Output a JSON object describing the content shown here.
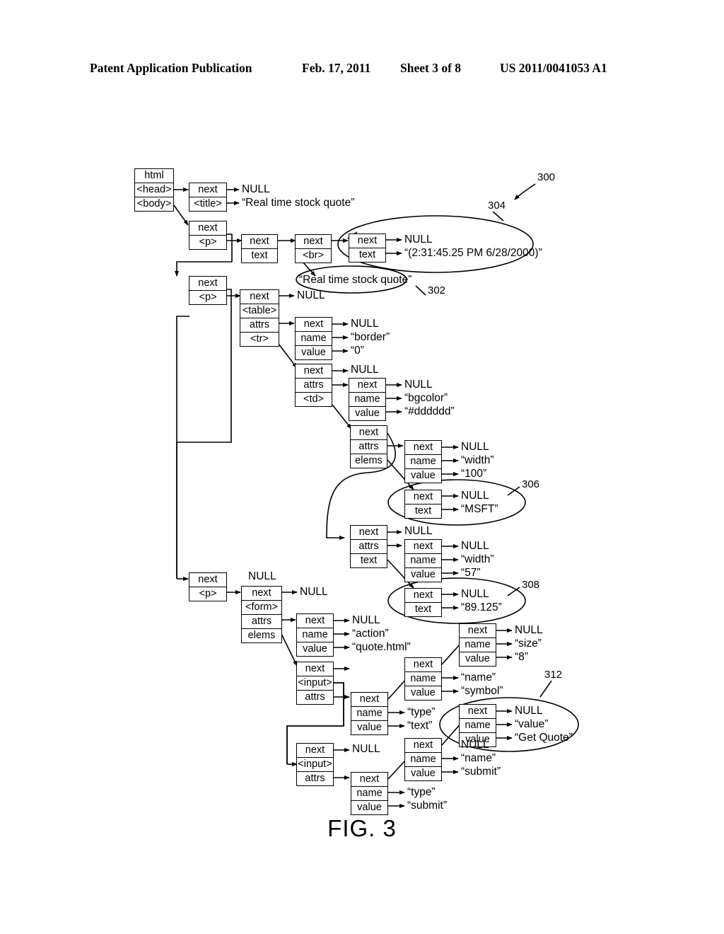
{
  "header": {
    "publication": "Patent Application Publication",
    "date": "Feb. 17, 2011",
    "sheet": "Sheet 3 of 8",
    "number": "US 2011/0041053 A1"
  },
  "figure": {
    "caption": "FIG. 3",
    "diagram_ref": "300"
  },
  "reference_numerals": {
    "r300": "300",
    "r302": "302",
    "r304": "304",
    "r306": "306",
    "r308": "308",
    "r312": "312"
  },
  "nodes": {
    "html_root": {
      "c0": "html",
      "c1": "<head>",
      "c2": "<body>"
    },
    "title": {
      "c0": "next",
      "c1": "<title>"
    },
    "p1": {
      "c0": "next",
      "c1": "<p>"
    },
    "p1_text": {
      "c0": "next",
      "c1": "text"
    },
    "br": {
      "c0": "next",
      "c1": "<br>"
    },
    "time_text": {
      "c0": "next",
      "c1": "text"
    },
    "p2": {
      "c0": "next",
      "c1": "<p>"
    },
    "table": {
      "c0": "next",
      "c1": "<table>",
      "c2": "attrs",
      "c3": "<tr>"
    },
    "attr_border": {
      "c0": "next",
      "c1": "name",
      "c2": "value"
    },
    "td": {
      "c0": "next",
      "c1": "attrs",
      "c2": "<td>"
    },
    "attr_bgcolor": {
      "c0": "next",
      "c1": "name",
      "c2": "value"
    },
    "td_elems": {
      "c0": "next",
      "c1": "attrs",
      "c2": "elems"
    },
    "attr_w100": {
      "c0": "next",
      "c1": "name",
      "c2": "value"
    },
    "msft_text": {
      "c0": "next",
      "c1": "text"
    },
    "td2": {
      "c0": "next",
      "c1": "attrs",
      "c2": "text"
    },
    "attr_w57": {
      "c0": "next",
      "c1": "name",
      "c2": "value"
    },
    "price_text": {
      "c0": "next",
      "c1": "text"
    },
    "p3": {
      "c0": "next",
      "c1": "<p>"
    },
    "form": {
      "c0": "next",
      "c1": "<form>",
      "c2": "attrs",
      "c3": "elems"
    },
    "attr_action": {
      "c0": "next",
      "c1": "name",
      "c2": "value"
    },
    "input1": {
      "c0": "next",
      "c1": "<input>",
      "c2": "attrs"
    },
    "attr_type_text": {
      "c0": "next",
      "c1": "name",
      "c2": "value"
    },
    "attr_name_symbol": {
      "c0": "next",
      "c1": "name",
      "c2": "value"
    },
    "attr_size_8": {
      "c0": "next",
      "c1": "name",
      "c2": "value"
    },
    "attr_value_getquote": {
      "c0": "next",
      "c1": "name",
      "c2": "value"
    },
    "input2": {
      "c0": "next",
      "c1": "<input>",
      "c2": "attrs"
    },
    "attr_type_submit": {
      "c0": "next",
      "c1": "name",
      "c2": "value"
    },
    "attr_name_submit": {
      "c0": "next",
      "c1": "name",
      "c2": "value"
    }
  },
  "values": {
    "null1": "NULL",
    "title_str": "“Real time stock quote”",
    "null2": "NULL",
    "time_str": "“(2:31:45.25 PM 6/28/2000)”",
    "p1_text_str": "“Real time stock quote”",
    "null_table": "NULL",
    "null_border": "NULL",
    "border_name": "“border”",
    "border_value": "“0”",
    "null_td": "NULL",
    "null_bgcolor": "NULL",
    "bgcolor_name": "“bgcolor”",
    "bgcolor_value": "“#dddddd”",
    "null_w100": "NULL",
    "w100_name": "“width”",
    "w100_value": "“100”",
    "null_msft": "NULL",
    "msft_value": "“MSFT”",
    "null_td2": "NULL",
    "null_w57": "NULL",
    "w57_name": "“width”",
    "w57_value": "“57”",
    "null_price": "NULL",
    "price_value": "“89.125”",
    "null_p3": "NULL",
    "null_form": "NULL",
    "null_action": "NULL",
    "action_name": "“action”",
    "action_value": "“quote.html”",
    "type_name": "“type”",
    "type_value": "“text”",
    "name_name": "“name”",
    "name_value": "“symbol”",
    "null_size": "NULL",
    "size_name": "“size”",
    "size_value": "“8”",
    "null_getquote": "NULL",
    "getquote_name": "“value”",
    "getquote_value": "“Get Quote”",
    "null_input2": "NULL",
    "null_submit_name": "NULL",
    "submit_name_name": "“name”",
    "submit_name_value": "“submit”",
    "submit_type_name": "“type”",
    "submit_type_value": "“submit”"
  }
}
